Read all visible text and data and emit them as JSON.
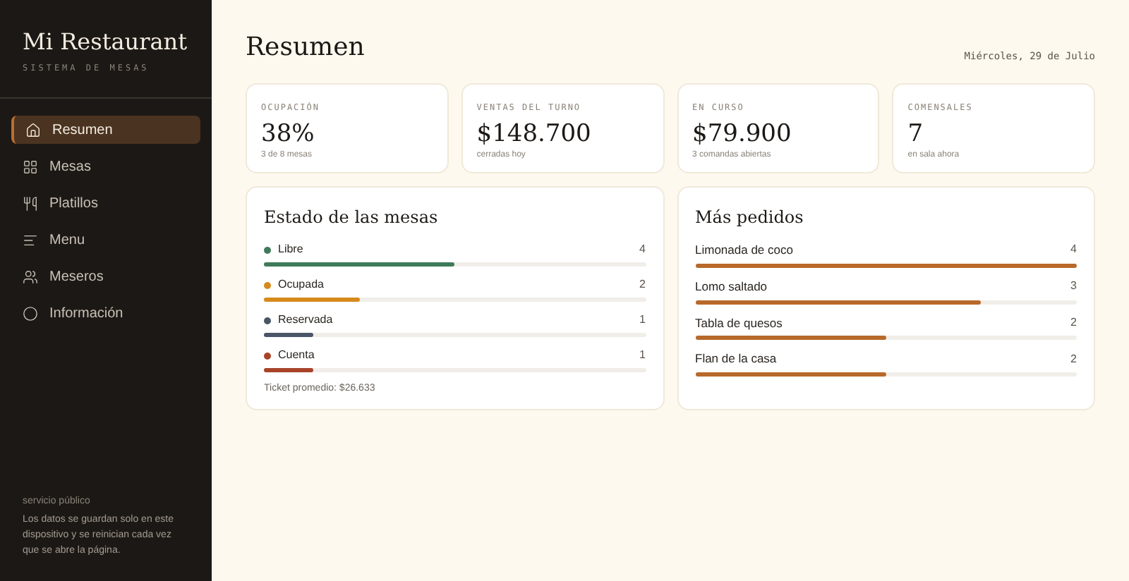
{
  "sidebar": {
    "title": "Mi Restaurant",
    "subtitle": "SISTEMA DE MESAS",
    "items": [
      {
        "label": "Resumen",
        "selected": true
      },
      {
        "label": "Mesas",
        "selected": false
      },
      {
        "label": "Platillos",
        "selected": false
      },
      {
        "label": "Menu",
        "selected": false
      },
      {
        "label": "Meseros",
        "selected": false
      },
      {
        "label": "Información",
        "selected": false
      }
    ],
    "footer_title": "servicio público",
    "footer_text": "Los datos se guardan solo en este dispositivo y se reinician cada vez que se abre la página."
  },
  "header": {
    "title": "Resumen",
    "date": "Miércoles, 29 de Julio"
  },
  "stats": [
    {
      "label": "OCUPACIÓN",
      "value": "38%",
      "note": "3 de 8 mesas"
    },
    {
      "label": "VENTAS DEL TURNO",
      "value": "$148.700",
      "note": "cerradas hoy"
    },
    {
      "label": "EN CURSO",
      "value": "$79.900",
      "note": "3 comandas abiertas"
    },
    {
      "label": "COMENSALES",
      "value": "7",
      "note": "en sala ahora"
    }
  ],
  "status_panel": {
    "title": "Estado de las mesas",
    "rows": [
      {
        "label": "Libre",
        "count": "4",
        "level": 0.5,
        "color": "#3f7a5a"
      },
      {
        "label": "Ocupada",
        "count": "2",
        "level": 0.25,
        "color": "#d68a1c"
      },
      {
        "label": "Reservada",
        "count": "1",
        "level": 0.13,
        "color": "#4a5668"
      },
      {
        "label": "Cuenta",
        "count": "1",
        "level": 0.13,
        "color": "#a8432a"
      }
    ],
    "footer": "Ticket promedio: $26.633"
  },
  "popular_panel": {
    "title": "Más pedidos",
    "rows": [
      {
        "label": "Limonada de coco",
        "count": "4",
        "level": 1
      },
      {
        "label": "Lomo saltado",
        "count": "3",
        "level": 0.75
      },
      {
        "label": "Tabla de quesos",
        "count": "2",
        "level": 0.5
      },
      {
        "label": "Flan de la casa",
        "count": "2",
        "level": 0.5
      }
    ]
  }
}
